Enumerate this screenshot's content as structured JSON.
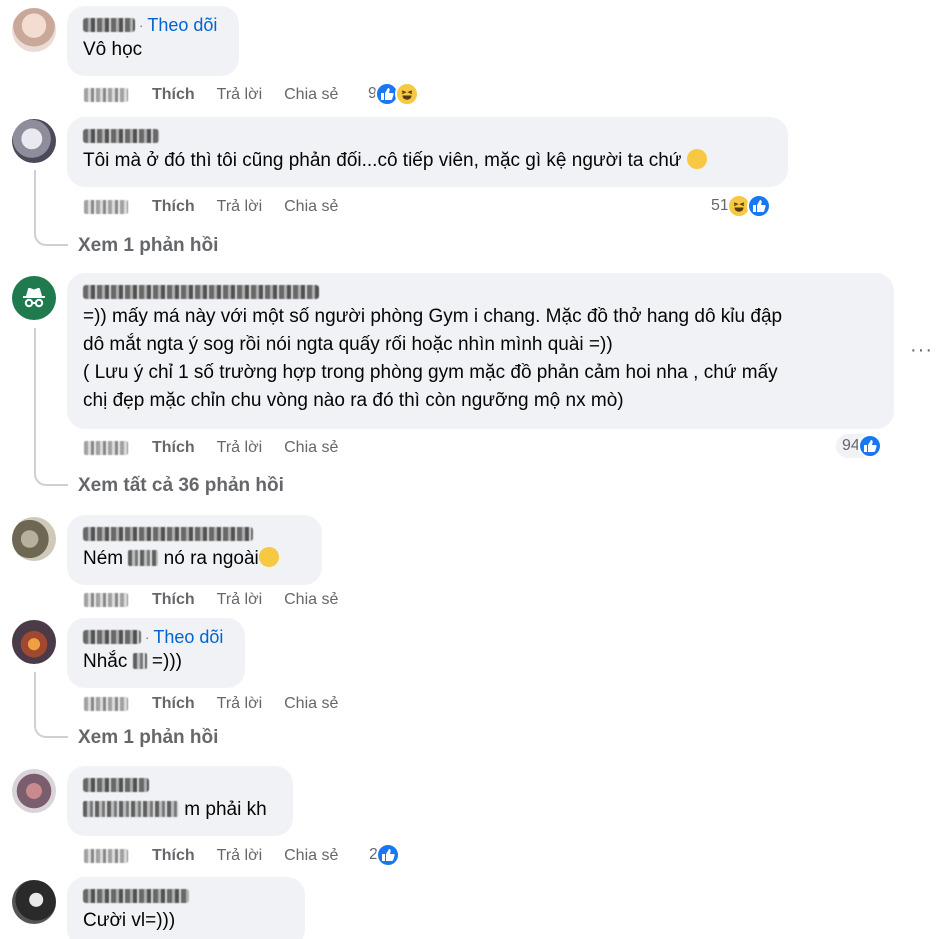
{
  "comments": [
    {
      "text": "Vô học",
      "follow": "Theo dõi",
      "actions": {
        "like": "Thích",
        "reply": "Trả lời",
        "share": "Chia sẻ"
      },
      "reaction_count": "9"
    },
    {
      "text": "Tôi mà ở đó thì tôi cũng phản đối...cô tiếp viên, mặc gì kệ người ta chứ",
      "actions": {
        "like": "Thích",
        "reply": "Trả lời",
        "share": "Chia sẻ"
      },
      "reaction_count": "51",
      "view_replies": "Xem 1 phản hồi"
    },
    {
      "text": "=)) mấy má này với một số người phòng Gym i chang. Mặc đồ thở hang dô kỉu đập\ndô mắt ngta ý sog rồi nói ngta quấy rối hoặc nhìn mình quài =))\n( Lưu ý chỉ 1 số trường hợp trong phòng gym mặc đồ phản cảm hoi nha , chứ mấy\nchị đẹp mặc chỉn chu vòng nào ra đó thì còn ngưỡng mộ nx mò)",
      "actions": {
        "like": "Thích",
        "reply": "Trả lời",
        "share": "Chia sẻ"
      },
      "reaction_count": "94",
      "view_replies": "Xem tất cả 36 phản hồi",
      "more": "···"
    },
    {
      "text_before": "Ném ",
      "text_after": " nó ra ngoài",
      "actions": {
        "like": "Thích",
        "reply": "Trả lời",
        "share": "Chia sẻ"
      }
    },
    {
      "text_before": "Nhắc ",
      "text_after": " =)))",
      "follow": "Theo dõi",
      "actions": {
        "like": "Thích",
        "reply": "Trả lời",
        "share": "Chia sẻ"
      },
      "view_replies": "Xem 1 phản hồi"
    },
    {
      "text_after": "m phải kh",
      "actions": {
        "like": "Thích",
        "reply": "Trả lời",
        "share": "Chia sẻ"
      },
      "reaction_count": "2"
    },
    {
      "text": "Cười vl=)))"
    }
  ],
  "colors": {
    "bubble": "#f0f2f5",
    "link_blue": "#0064d1",
    "like_blue": "#1877f2",
    "secondary_text": "#65676b"
  },
  "icons": [
    "like-reaction-icon",
    "haha-reaction-icon",
    "incognito-icon",
    "more-options-icon"
  ]
}
